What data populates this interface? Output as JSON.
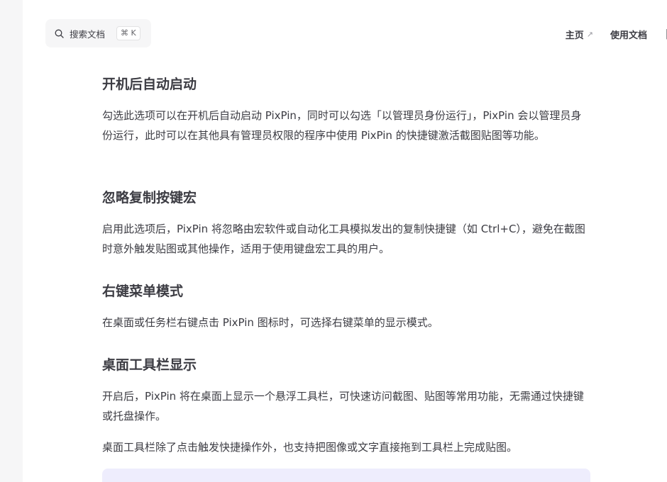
{
  "search": {
    "placeholder": "搜索文档",
    "shortcut": "⌘ K"
  },
  "nav": {
    "home": "主页",
    "home_arrow": "↗",
    "docs": "使用文档"
  },
  "sections": [
    {
      "title": "开机后自动启动",
      "paragraphs": [
        "勾选此选项可以在开机后自动启动 PixPin，同时可以勾选「以管理员身份运行」，PixPin 会以管理员身份运行，此时可以在其他具有管理员权限的程序中使用 PixPin 的快捷键激活截图贴图等功能。"
      ]
    },
    {
      "title": "忽略复制按键宏",
      "paragraphs": [
        "启用此选项后，PixPin 将忽略由宏软件或自动化工具模拟发出的复制快捷键（如 Ctrl+C），避免在截图时意外触发贴图或其他操作，适用于使用键盘宏工具的用户。"
      ]
    },
    {
      "title": "右键菜单模式",
      "paragraphs": [
        "在桌面或任务栏右键点击 PixPin 图标时，可选择右键菜单的显示模式。"
      ]
    },
    {
      "title": "桌面工具栏显示",
      "paragraphs": [
        "开启后，PixPin 将在桌面上显示一个悬浮工具栏，可快速访问截图、贴图等常用功能，无需通过快捷键或托盘操作。",
        "桌面工具栏除了点击触发快捷操作外，也支持把图像或文字直接拖到工具栏上完成贴图。"
      ]
    }
  ],
  "colors": {
    "text": "#3c3c43",
    "search_bg": "#f6f6f7",
    "tip_bg": "#eeedfd"
  }
}
